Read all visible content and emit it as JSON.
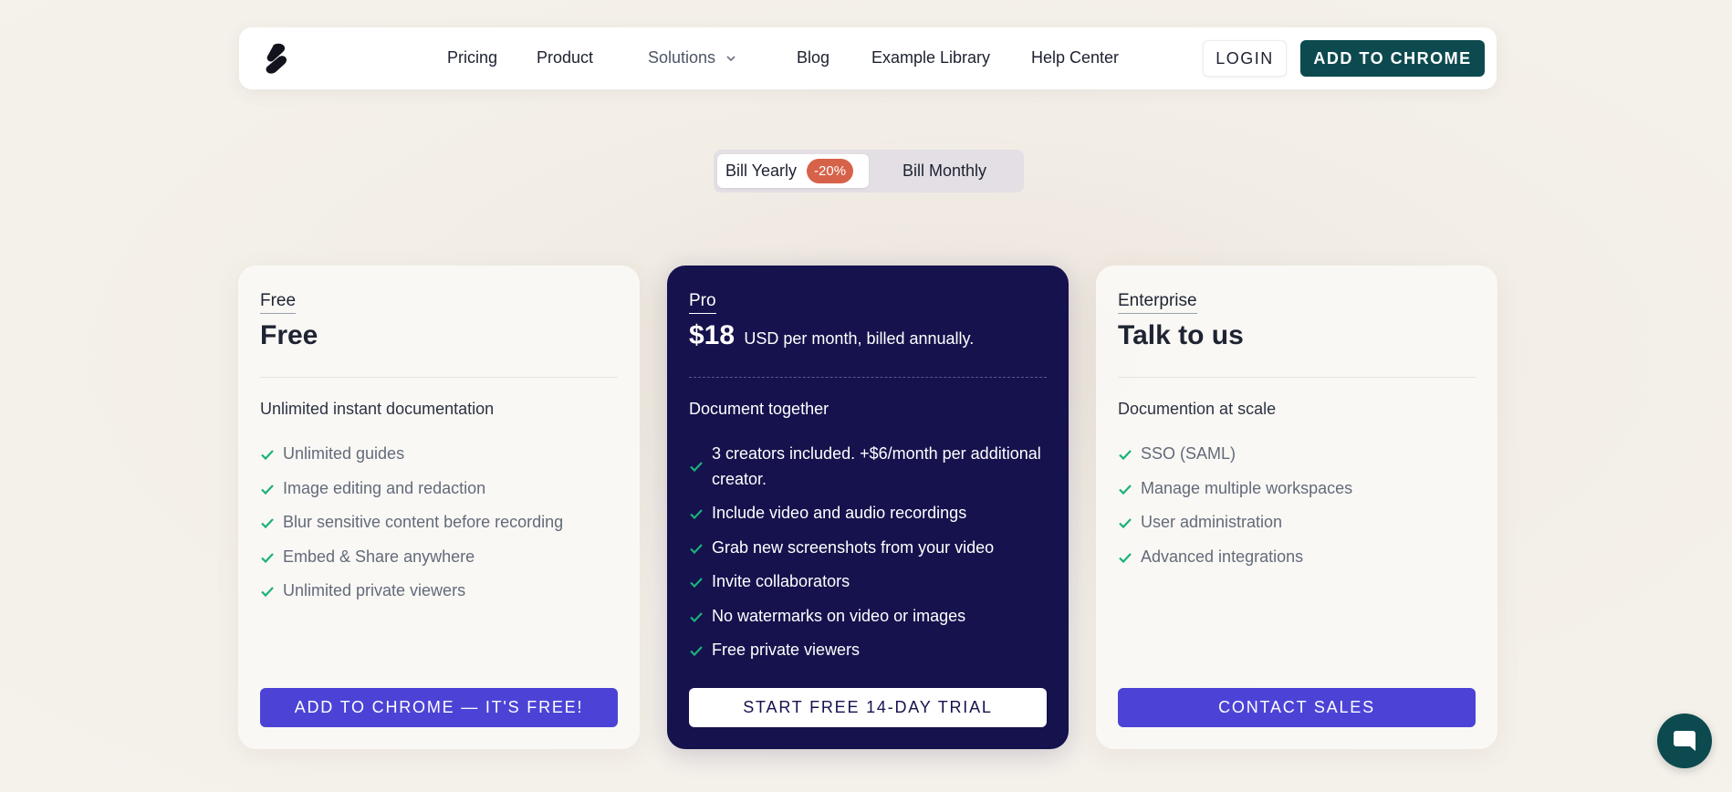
{
  "nav": {
    "links": [
      "Pricing",
      "Product",
      "Solutions",
      "Blog",
      "Example Library",
      "Help Center"
    ],
    "login_label": "LOGIN",
    "cta_label": "ADD TO CHROME"
  },
  "billing_toggle": {
    "yearly_label": "Bill Yearly",
    "yearly_badge": "-20%",
    "monthly_label": "Bill Monthly",
    "selected": "yearly"
  },
  "plans": [
    {
      "tag": "Free",
      "price": "Free",
      "price_sub": "",
      "tagline": "Unlimited instant documentation",
      "features": [
        "Unlimited guides",
        "Image editing and redaction",
        "Blur sensitive content before recording",
        "Embed & Share anywhere",
        "Unlimited private viewers"
      ],
      "cta": "ADD TO CHROME — IT'S FREE!"
    },
    {
      "tag": "Pro",
      "price": "$18",
      "price_sub": "USD per month, billed annually.",
      "tagline": "Document together",
      "features": [
        "3 creators included. +$6/month per additional creator.",
        "Include video and audio recordings",
        "Grab new screenshots from your video",
        "Invite collaborators",
        "No watermarks on video or images",
        "Free private viewers"
      ],
      "cta": "START FREE 14-DAY TRIAL"
    },
    {
      "tag": "Enterprise",
      "price": "Talk to us",
      "price_sub": "",
      "tagline": "Documention at scale",
      "features": [
        "SSO (SAML)",
        "Manage multiple workspaces",
        "User administration",
        "Advanced integrations"
      ],
      "cta": "CONTACT SALES"
    }
  ],
  "colors": {
    "brand_dark_teal": "#0c4a4f",
    "pro_card_bg": "#15124d",
    "cta_purple": "#4c43d6",
    "check_green": "#1bb07a",
    "badge_red": "#d7624a"
  },
  "icons": {
    "logo": "brand-logo-icon",
    "solutions_chevron": "chevron-down-icon",
    "feature_check": "check-icon",
    "chat": "chat-bubble-icon"
  }
}
